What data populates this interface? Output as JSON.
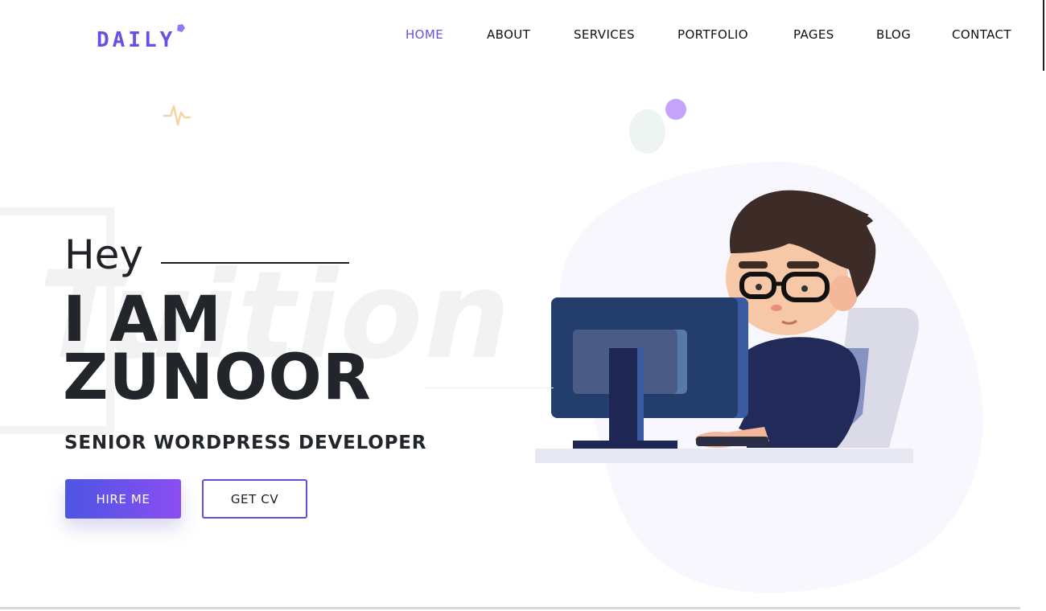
{
  "logo": {
    "text": "DAILY",
    "color": "#6c4ee4",
    "dot_color": "#8a7cf2"
  },
  "nav": {
    "items": [
      {
        "label": "HOME",
        "active": true
      },
      {
        "label": "ABOUT",
        "active": false
      },
      {
        "label": "SERVICES",
        "active": false
      },
      {
        "label": "PORTFOLIO",
        "active": false
      },
      {
        "label": "PAGES",
        "active": false
      },
      {
        "label": "BLOG",
        "active": false
      },
      {
        "label": "CONTACT",
        "active": false
      }
    ],
    "active_color": "#6c4ee4"
  },
  "hero": {
    "greeting": "Hey",
    "name_line1": "I AM",
    "name_line2": "ZUNOOR",
    "role": "SENIOR WORDPRESS DEVELOPER",
    "background_word": "Tuition",
    "hire_button": "HIRE ME",
    "cv_button": "GET CV"
  },
  "colors": {
    "accent_start": "#4c55e3",
    "accent_end": "#8b4ef2",
    "blob": "#f8f7fe",
    "pulse_icon": "#f6d3a0"
  },
  "icons": {
    "pulse": "heartbeat-pulse-icon",
    "illustration": "developer-at-computer-illustration"
  }
}
